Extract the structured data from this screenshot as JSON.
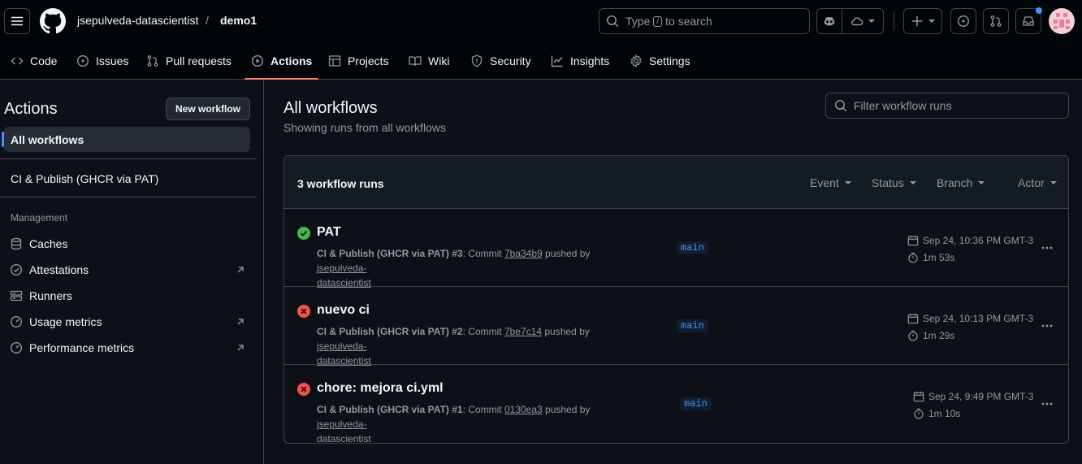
{
  "header": {
    "owner": "jsepulveda-datascientist",
    "separator": "/",
    "repo": "demo1",
    "search": {
      "prefix": "Type",
      "key": "/",
      "suffix": "to search"
    }
  },
  "repo_nav": {
    "tabs": [
      {
        "label": "Code",
        "icon": "code-icon"
      },
      {
        "label": "Issues",
        "icon": "issue-icon"
      },
      {
        "label": "Pull requests",
        "icon": "pull-request-icon"
      },
      {
        "label": "Actions",
        "icon": "play-icon",
        "active": true
      },
      {
        "label": "Projects",
        "icon": "table-icon"
      },
      {
        "label": "Wiki",
        "icon": "book-icon"
      },
      {
        "label": "Security",
        "icon": "shield-icon"
      },
      {
        "label": "Insights",
        "icon": "graph-icon"
      },
      {
        "label": "Settings",
        "icon": "gear-icon"
      }
    ]
  },
  "sidebar": {
    "title": "Actions",
    "new_workflow": "New workflow",
    "all_workflows": "All workflows",
    "workflow": "CI & Publish (GHCR via PAT)",
    "management_label": "Management",
    "management": [
      {
        "label": "Caches",
        "icon": "database-icon",
        "external": false
      },
      {
        "label": "Attestations",
        "icon": "verified-icon",
        "external": true
      },
      {
        "label": "Runners",
        "icon": "server-icon",
        "external": false
      },
      {
        "label": "Usage metrics",
        "icon": "meter-icon",
        "external": true
      },
      {
        "label": "Performance metrics",
        "icon": "meter-icon",
        "external": true
      }
    ]
  },
  "main": {
    "title": "All workflows",
    "subtitle": "Showing runs from all workflows",
    "filter_placeholder": "Filter workflow runs",
    "runs_count": "3 workflow runs",
    "filters": [
      "Event",
      "Status",
      "Branch",
      "Actor"
    ],
    "runs": [
      {
        "status": "success",
        "title": "PAT",
        "workflow": "CI & Publish (GHCR via PAT)",
        "run_no": "#3",
        "commit_word": "Commit",
        "commit": "7ba34b9",
        "pushed_by": "pushed by",
        "user_a": "jsepulveda-",
        "user_b": "datascientist",
        "branch": "main",
        "date": "Sep 24, 10:36 PM GMT-3",
        "duration": "1m 53s"
      },
      {
        "status": "failure",
        "title": "nuevo ci",
        "workflow": "CI & Publish (GHCR via PAT)",
        "run_no": "#2",
        "commit_word": "Commit",
        "commit": "7be7c14",
        "pushed_by": "pushed by",
        "user_a": "jsepulveda-",
        "user_b": "datascientist",
        "branch": "main",
        "date": "Sep 24, 10:13 PM GMT-3",
        "duration": "1m 29s"
      },
      {
        "status": "failure",
        "title": "chore: mejora ci.yml",
        "workflow": "CI & Publish (GHCR via PAT)",
        "run_no": "#1",
        "commit_word": "Commit",
        "commit": "0130ea3",
        "pushed_by": "pushed by",
        "user_a": "jsepulveda-",
        "user_b": "datascientist",
        "branch": "main",
        "date": "Sep 24, 9:49 PM GMT-3",
        "duration": "1m 10s"
      }
    ]
  },
  "colors": {
    "success": "#3fb950",
    "failure": "#f85149",
    "accent": "#4493f8",
    "active_tab": "#f78166"
  }
}
